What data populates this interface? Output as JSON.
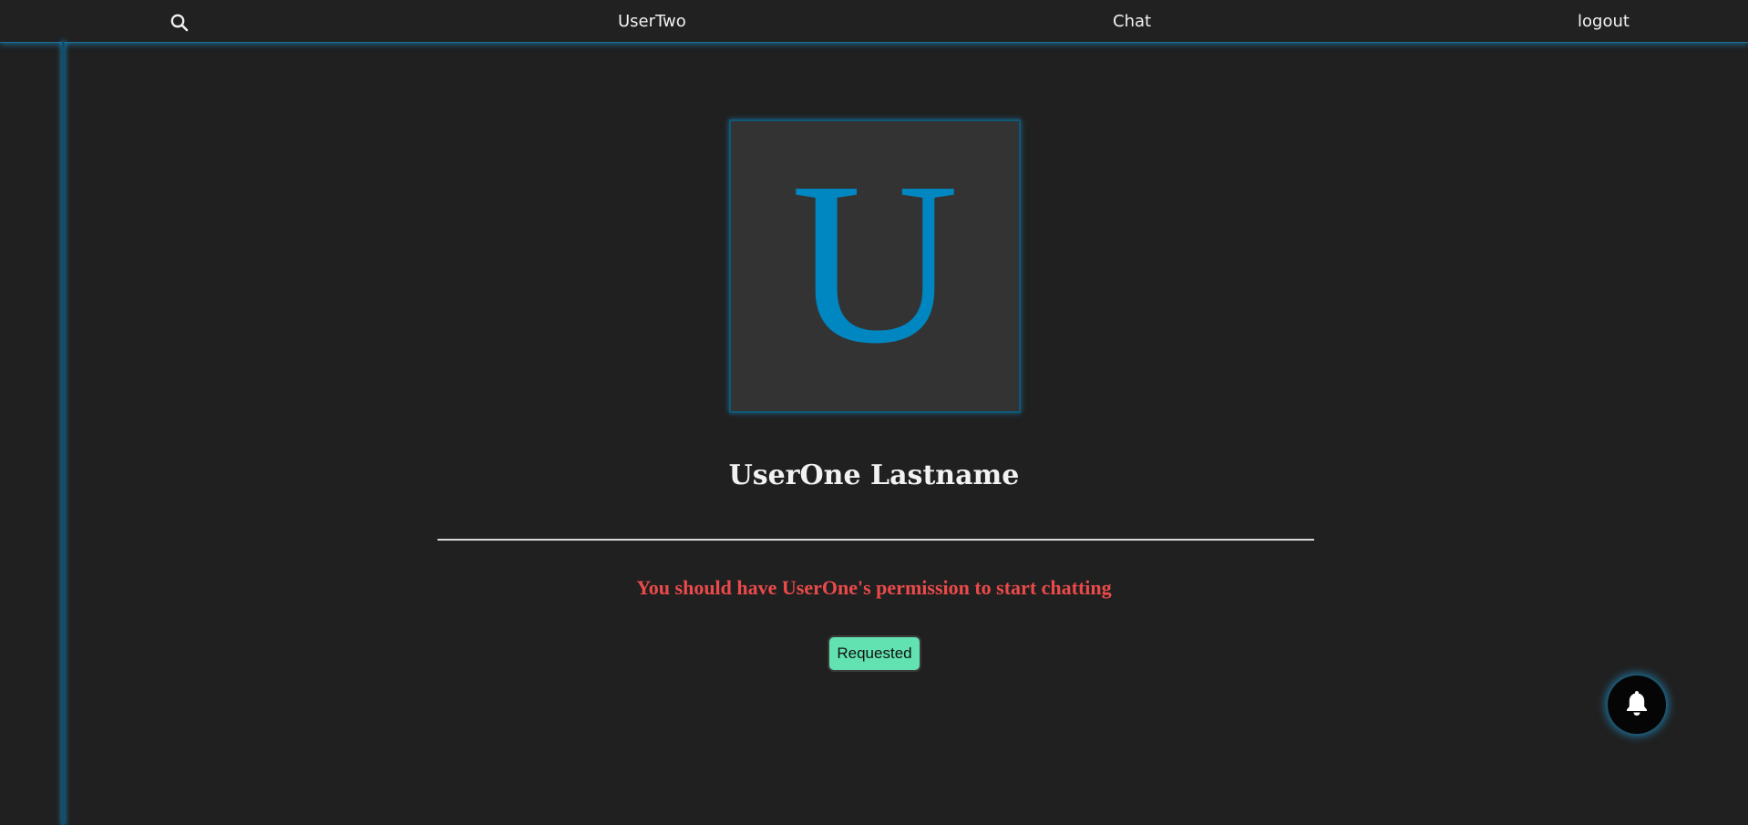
{
  "nav": {
    "search_icon": "search-icon",
    "user_label": "UserTwo",
    "chat_label": "Chat",
    "logout_label": "logout"
  },
  "profile": {
    "avatar_letter": "U",
    "name": "UserOne Lastname",
    "permission_message": "You should have UserOne's permission to start chatting",
    "request_button_label": "Requested"
  },
  "notifications": {
    "bell_icon": "bell-icon"
  },
  "colors": {
    "background": "#202020",
    "accent": "#0086c0",
    "warning": "#ec4a4a",
    "button": "#62e2b1"
  }
}
